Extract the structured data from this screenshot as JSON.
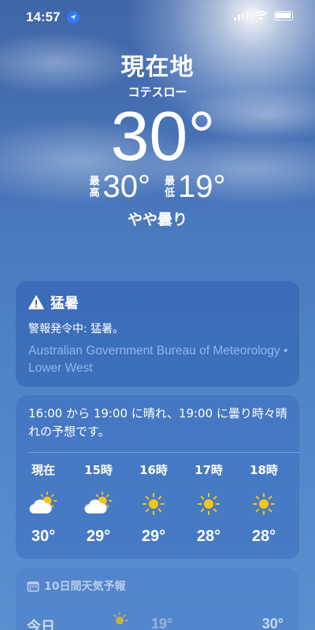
{
  "status_bar": {
    "time": "14:57"
  },
  "location": {
    "title": "現在地",
    "subtitle": "コテスロー",
    "temperature": "30°",
    "high_label_top": "最",
    "high_label_bottom": "高",
    "high": "30°",
    "low_label_top": "最",
    "low_label_bottom": "低",
    "low": "19°",
    "condition": "やや曇り"
  },
  "alert": {
    "title": "猛暑",
    "body": "警報発令中: 猛暑。",
    "source": "Australian Government Bureau of Meteorology • Lower West",
    "icon": "warning-triangle-icon"
  },
  "hourly": {
    "summary": "16:00 から 19:00 に晴れ、19:00 に曇り時々晴れの予想です。",
    "hours": [
      {
        "label": "現在",
        "icon": "partly-sunny-icon",
        "temp": "30°"
      },
      {
        "label": "15時",
        "icon": "partly-sunny-icon",
        "temp": "29°"
      },
      {
        "label": "16時",
        "icon": "sunny-icon",
        "temp": "29°"
      },
      {
        "label": "17時",
        "icon": "sunny-icon",
        "temp": "28°"
      },
      {
        "label": "18時",
        "icon": "sunny-icon",
        "temp": "28°"
      }
    ]
  },
  "forecast": {
    "title": "10日間天気予報",
    "first_day": {
      "day": "今日",
      "low": "19°",
      "high": "30°"
    }
  },
  "colors": {
    "sun": "#f5c518",
    "alert_link": "#8fb6f0",
    "location_arrow": "#2f7bf6"
  }
}
